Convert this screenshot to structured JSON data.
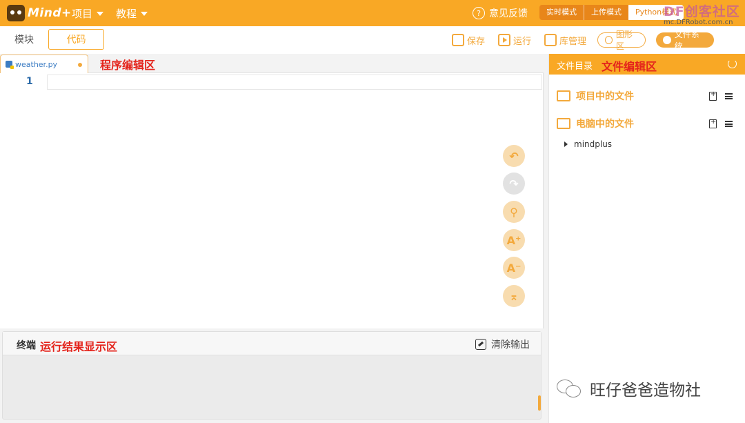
{
  "topbar": {
    "logo_text": "Mind+",
    "menu": [
      {
        "label": "项目"
      },
      {
        "label": "教程"
      }
    ],
    "feedback_label": "意见反馈",
    "modes": [
      {
        "label": "实时模式"
      },
      {
        "label": "上传模式"
      },
      {
        "label": "Python模式"
      }
    ],
    "watermark_title": "DF创客社区",
    "watermark_url": "mc.DFRobot.com.cn"
  },
  "tabs": {
    "blocks": "模块",
    "code": "代码"
  },
  "toolbar": {
    "save": "保存",
    "run": "运行",
    "library": "库管理",
    "graph": "图形区",
    "filesystem": "文件系统"
  },
  "editor": {
    "file_tab": "weather.py",
    "annotation": "程序编辑区",
    "line_number": "1"
  },
  "terminal": {
    "title": "终端",
    "annotation": "运行结果显示区",
    "clear_label": "清除输出"
  },
  "files_panel": {
    "title": "文件目录",
    "annotation": "文件编辑区",
    "sections": [
      {
        "label": "项目中的文件"
      },
      {
        "label": "电脑中的文件"
      }
    ],
    "tree": [
      {
        "label": "mindplus"
      }
    ]
  },
  "watermark_bottom": "旺仔爸爸造物社",
  "colors": {
    "accent": "#f9a825",
    "annotation_red": "#e4241c"
  }
}
